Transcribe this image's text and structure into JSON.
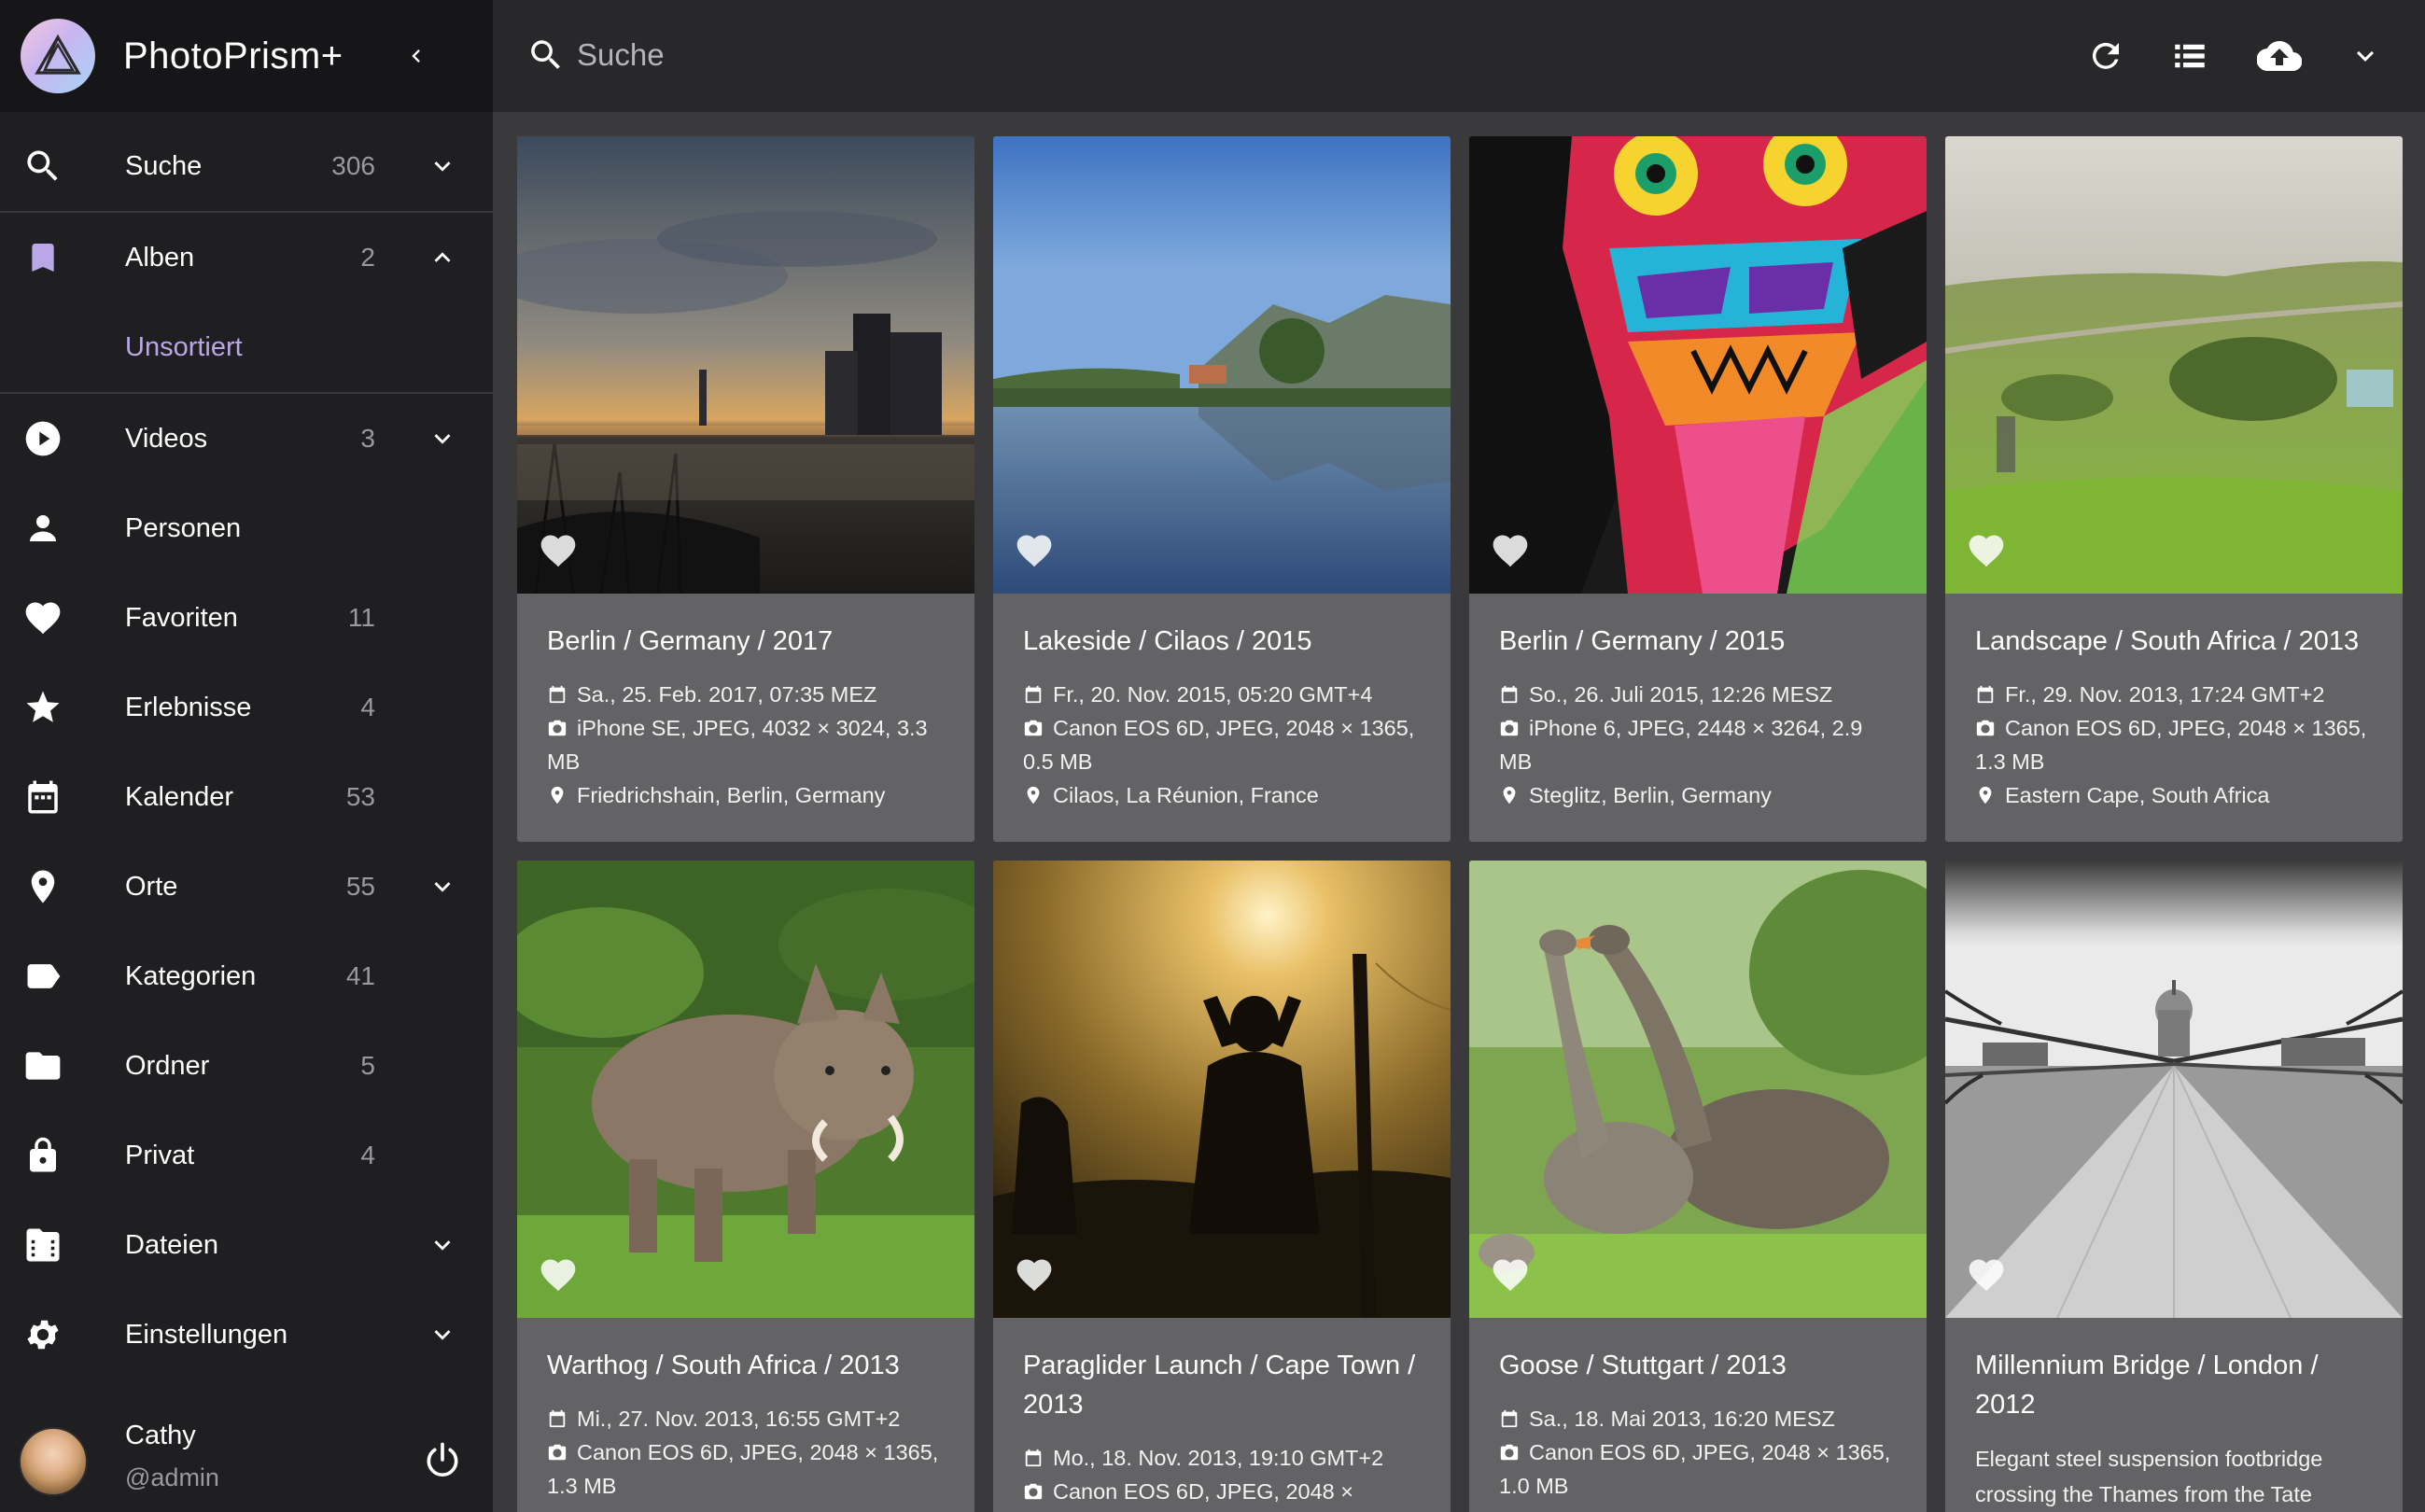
{
  "app": {
    "title": "PhotoPrism+"
  },
  "topbar": {
    "search_placeholder": "Suche"
  },
  "sidebar": {
    "items": [
      {
        "name": "search",
        "label": "Suche",
        "count": "306",
        "chevron": "down",
        "icon": "search-icon"
      },
      {
        "name": "albums",
        "label": "Alben",
        "count": "2",
        "chevron": "up",
        "icon": "bookmark-icon"
      },
      {
        "name": "videos",
        "label": "Videos",
        "count": "3",
        "chevron": "down",
        "icon": "play-circle-icon"
      },
      {
        "name": "people",
        "label": "Personen",
        "count": "",
        "chevron": "",
        "icon": "person-icon"
      },
      {
        "name": "favorites",
        "label": "Favoriten",
        "count": "11",
        "chevron": "",
        "icon": "heart-icon"
      },
      {
        "name": "moments",
        "label": "Erlebnisse",
        "count": "4",
        "chevron": "",
        "icon": "star-icon"
      },
      {
        "name": "calendar",
        "label": "Kalender",
        "count": "53",
        "chevron": "",
        "icon": "calendar-icon"
      },
      {
        "name": "places",
        "label": "Orte",
        "count": "55",
        "chevron": "down",
        "icon": "map-pin-icon"
      },
      {
        "name": "labels",
        "label": "Kategorien",
        "count": "41",
        "chevron": "",
        "icon": "label-icon"
      },
      {
        "name": "folders",
        "label": "Ordner",
        "count": "5",
        "chevron": "",
        "icon": "folder-icon"
      },
      {
        "name": "private",
        "label": "Privat",
        "count": "4",
        "chevron": "",
        "icon": "lock-icon"
      },
      {
        "name": "files",
        "label": "Dateien",
        "count": "",
        "chevron": "down",
        "icon": "files-icon"
      },
      {
        "name": "settings",
        "label": "Einstellungen",
        "count": "",
        "chevron": "down",
        "icon": "gear-icon"
      }
    ],
    "sub_item": "Unsortiert",
    "user": {
      "name": "Cathy",
      "role": "@admin"
    }
  },
  "photos": [
    {
      "title": "Berlin / Germany / 2017",
      "date": "Sa., 25. Feb. 2017, 07:35 MEZ",
      "camera": "iPhone SE, JPEG, 4032 × 3024, 3.3 MB",
      "location": "Friedrichshain, Berlin, Germany"
    },
    {
      "title": "Lakeside / Cilaos / 2015",
      "date": "Fr., 20. Nov. 2015, 05:20 GMT+4",
      "camera": "Canon EOS 6D, JPEG, 2048 × 1365, 0.5 MB",
      "location": "Cilaos, La Réunion, France"
    },
    {
      "title": "Berlin / Germany / 2015",
      "date": "So., 26. Juli 2015, 12:26 MESZ",
      "camera": "iPhone 6, JPEG, 2448 × 3264, 2.9 MB",
      "location": "Steglitz, Berlin, Germany"
    },
    {
      "title": "Landscape / South Africa / 2013",
      "date": "Fr., 29. Nov. 2013, 17:24 GMT+2",
      "camera": "Canon EOS 6D, JPEG, 2048 × 1365, 1.3 MB",
      "location": "Eastern Cape, South Africa"
    },
    {
      "title": "Warthog / South Africa / 2013",
      "date": "Mi., 27. Nov. 2013, 16:55 GMT+2",
      "camera": "Canon EOS 6D, JPEG, 2048 × 1365, 1.3 MB",
      "location": ""
    },
    {
      "title": "Paraglider Launch / Cape Town / 2013",
      "date": "Mo., 18. Nov. 2013, 19:10 GMT+2",
      "camera": "Canon EOS 6D, JPEG, 2048 ×",
      "location": ""
    },
    {
      "title": "Goose / Stuttgart / 2013",
      "date": "Sa., 18. Mai 2013, 16:20 MESZ",
      "camera": "Canon EOS 6D, JPEG, 2048 × 1365, 1.0 MB",
      "location": ""
    },
    {
      "title": "Millennium Bridge / London / 2012",
      "caption": "Elegant steel suspension footbridge crossing the Thames from the Tate"
    }
  ],
  "colors": {
    "sidebar_bg": "#1f1f21",
    "topbar_bg": "#28282a",
    "content_bg": "#3a3a3c",
    "card_bg": "#636365",
    "accent": "#b9a7e8"
  }
}
